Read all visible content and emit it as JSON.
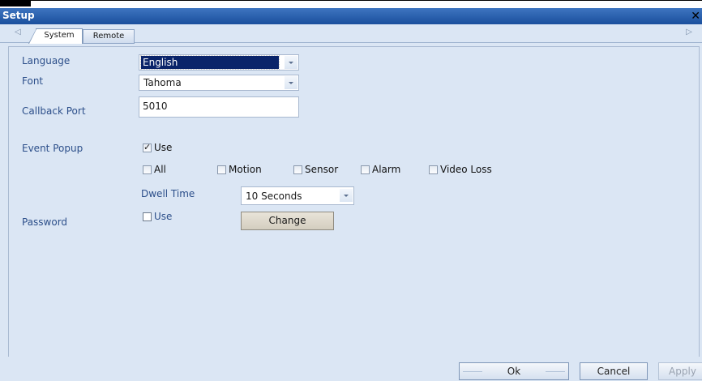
{
  "window": {
    "title": "Setup",
    "close_glyph": "✕"
  },
  "tabs": {
    "nav_left": "◁",
    "nav_right": "▷",
    "items": [
      {
        "label": "System",
        "active": true
      },
      {
        "label": "Remote",
        "active": false
      }
    ]
  },
  "system": {
    "language": {
      "label": "Language",
      "value": "English"
    },
    "font": {
      "label": "Font",
      "value": "Tahoma"
    },
    "callback_port": {
      "label": "Callback Port",
      "value": "5010"
    },
    "event_popup": {
      "label": "Event Popup",
      "use": {
        "label": "Use",
        "checked": true
      },
      "events": [
        {
          "label": "All",
          "checked": false
        },
        {
          "label": "Motion",
          "checked": false
        },
        {
          "label": "Sensor",
          "checked": false
        },
        {
          "label": "Alarm",
          "checked": false
        },
        {
          "label": "Video Loss",
          "checked": false
        }
      ],
      "dwell_time": {
        "label": "Dwell Time",
        "value": "10 Seconds"
      }
    },
    "password": {
      "label": "Password",
      "use": {
        "label": "Use",
        "checked": false
      },
      "change_label": "Change"
    }
  },
  "footer": {
    "ok": "Ok",
    "cancel": "Cancel",
    "apply": "Apply"
  },
  "colors": {
    "title_bar": "#1a4f9d",
    "panel_bg": "#dbe6f4",
    "label_text": "#2c4f8a",
    "selection": "#0a246a"
  },
  "icons": {
    "close": "close-icon",
    "nav_left": "tab-scroll-left-icon",
    "nav_right": "tab-scroll-right-icon",
    "dropdown": "chevron-down-icon"
  }
}
